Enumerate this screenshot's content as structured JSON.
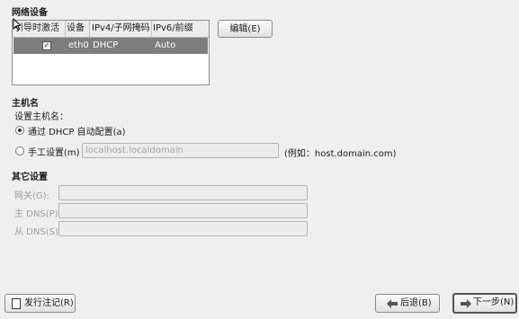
{
  "network": {
    "section_title": "网络设备",
    "columns": [
      "引导时激活",
      "设备",
      "IPv4/子网掩码",
      "IPv6/前缀"
    ],
    "rows": [
      {
        "active": "✓",
        "device": "eth0",
        "ipv4": "DHCP",
        "ipv6": "Auto"
      }
    ],
    "edit_label": "编辑(E)"
  },
  "hostname": {
    "section_title": "主机名",
    "set_label": "设置主机名：",
    "dhcp_option_label": "通过 DHCP 自动配置(a)",
    "manual_option_label": "手工设置(m)",
    "manual_value": "localhost.localdomain",
    "example_label": "(例如：host.domain.com)"
  },
  "other": {
    "section_title": "其它设置",
    "gateway_label": "网关(G):",
    "primary_dns_label": "主 DNS(P):",
    "secondary_dns_label": "从 DNS(S):"
  },
  "footer": {
    "release_notes_label": "发行注记(R)",
    "back_label": "后退(B)",
    "next_label": "下一步(N)"
  }
}
